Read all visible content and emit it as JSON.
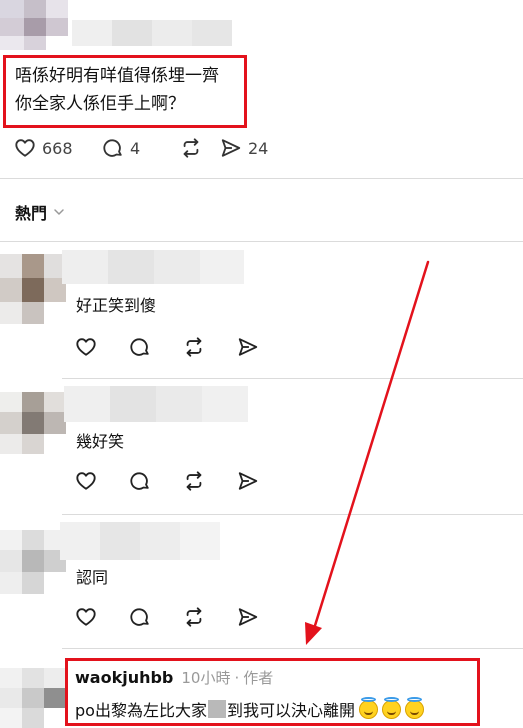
{
  "post": {
    "text_line1": "唔係好明有咩值得係埋一齊",
    "text_line2": "你全家人係佢手上啊？",
    "likes": "668",
    "replies": "4",
    "shares": "24"
  },
  "sort": {
    "label": "熱門"
  },
  "comments": [
    {
      "text": "好正笑到傻"
    },
    {
      "text": "幾好笑"
    },
    {
      "text": "認同"
    }
  ],
  "author_reply": {
    "username": "waokjuhbb",
    "time": "10小時",
    "separator": "·",
    "role": "作者",
    "text_before": "po出黎為左比大家",
    "text_after": "到我可以決心離開"
  },
  "colors": {
    "highlight_red": "#e3121c",
    "divider": "#dbdbdb",
    "icon": "#222222",
    "meta": "#999999"
  }
}
